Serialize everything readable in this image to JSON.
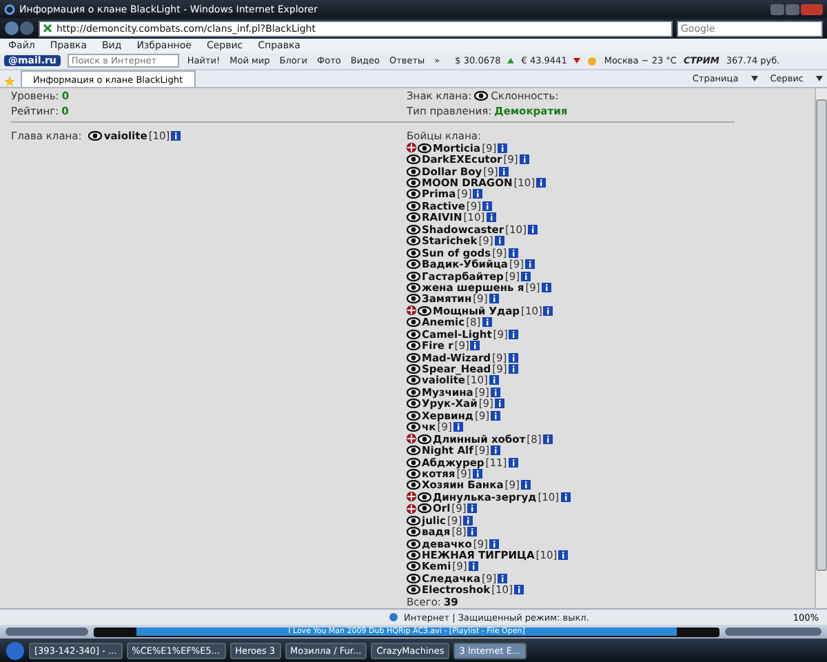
{
  "window": {
    "title": "Информация о клане BlackLight - Windows Internet Explorer"
  },
  "address_bar": {
    "url": "http://demoncity.combats.com/clans_inf.pl?BlackLight",
    "search_placeholder": "Google"
  },
  "menu": [
    "Файл",
    "Правка",
    "Вид",
    "Избранное",
    "Сервис",
    "Справка"
  ],
  "mail_toolbar": {
    "logo": "@mail.ru",
    "search_placeholder": "Поиск в Интернет",
    "search_button": "Найти!",
    "links": [
      "Мой мир",
      "Блоги",
      "Фото",
      "Видео",
      "Ответы"
    ],
    "more": "»",
    "usd": "$ 30.0678",
    "eur": "€ 43.9441",
    "weather": "Москва − 23 °C",
    "stream": "СТРИМ",
    "balance": "367.74 руб."
  },
  "tabs": [
    {
      "label": "Информация о клане BlackLight",
      "selected": true
    }
  ],
  "command_bar": [
    "Страница",
    "Сервис"
  ],
  "clan": {
    "level_label": "Уровень:",
    "level": "0",
    "rating_label": "Рейтинг:",
    "rating": "0",
    "sign_label": "Знак клана:",
    "alignment_label": "Склонность:",
    "government_label": "Тип правления:",
    "government": "Демократия",
    "head_label": "Глава клана:",
    "head": {
      "name": "vaiolite",
      "level": "[10]"
    },
    "members_label": "Бойцы клана:",
    "members": [
      {
        "name": "Morticia",
        "level": "[9]",
        "emblem": true
      },
      {
        "name": "DarkEXEcutor",
        "level": "[9]",
        "emblem": false
      },
      {
        "name": "Dollar Boy",
        "level": "[9]",
        "emblem": false
      },
      {
        "name": "MOON DRAGON",
        "level": "[10]",
        "emblem": false
      },
      {
        "name": "Prima",
        "level": "[9]",
        "emblem": false
      },
      {
        "name": "Ractive",
        "level": "[9]",
        "emblem": false
      },
      {
        "name": "RAIVIN",
        "level": "[10]",
        "emblem": false
      },
      {
        "name": "Shadowcaster",
        "level": "[10]",
        "emblem": false
      },
      {
        "name": "Starichek",
        "level": "[9]",
        "emblem": false
      },
      {
        "name": "Sun of gods",
        "level": "[9]",
        "emblem": false
      },
      {
        "name": "Вадик-Убийца",
        "level": "[9]",
        "emblem": false
      },
      {
        "name": "Гастарбайтер",
        "level": "[9]",
        "emblem": false
      },
      {
        "name": "жена шершень я",
        "level": "[9]",
        "emblem": false
      },
      {
        "name": "Замятин",
        "level": "[9]",
        "emblem": false
      },
      {
        "name": "Мощный Удар",
        "level": "[10]",
        "emblem": true
      },
      {
        "name": "Anemic",
        "level": "[8]",
        "emblem": false
      },
      {
        "name": "Camel-Light",
        "level": "[9]",
        "emblem": false
      },
      {
        "name": "Fire r",
        "level": "[9]",
        "emblem": false
      },
      {
        "name": "Mad-Wizard",
        "level": "[9]",
        "emblem": false
      },
      {
        "name": "Spear_Head",
        "level": "[9]",
        "emblem": false
      },
      {
        "name": "vaiolite",
        "level": "[10]",
        "emblem": false
      },
      {
        "name": "Музчина",
        "level": "[9]",
        "emblem": false
      },
      {
        "name": "Урук-Хай",
        "level": "[9]",
        "emblem": false
      },
      {
        "name": "Хервинд",
        "level": "[9]",
        "emblem": false
      },
      {
        "name": "чк",
        "level": "[9]",
        "emblem": false
      },
      {
        "name": "Длинный хобот",
        "level": "[8]",
        "emblem": true
      },
      {
        "name": "Night Alf",
        "level": "[9]",
        "emblem": false
      },
      {
        "name": "Абджурер",
        "level": "[11]",
        "emblem": false
      },
      {
        "name": "котяя",
        "level": "[9]",
        "emblem": false
      },
      {
        "name": "Хозяин Банка",
        "level": "[9]",
        "emblem": false
      },
      {
        "name": "Динулька-зергуд",
        "level": "[10]",
        "emblem": true
      },
      {
        "name": "Orl",
        "level": "[9]",
        "emblem": true
      },
      {
        "name": "julic",
        "level": "[9]",
        "emblem": false
      },
      {
        "name": "вадя",
        "level": "[8]",
        "emblem": false
      },
      {
        "name": "девачко",
        "level": "[9]",
        "emblem": false
      },
      {
        "name": "НЕЖНАЯ ТИГРИЦА",
        "level": "[10]",
        "emblem": false
      },
      {
        "name": "Kemi",
        "level": "[9]",
        "emblem": false
      },
      {
        "name": "Следачка",
        "level": "[9]",
        "emblem": false
      },
      {
        "name": "Electroshok",
        "level": "[10]",
        "emblem": false
      }
    ],
    "total_label": "Всего:",
    "total": "39"
  },
  "status_bar": {
    "zone": "Интернет | Защищенный режим: выкл.",
    "zoom": "100%"
  },
  "media_player": {
    "track": "I Love You Man 2009 Dub HQRip AC3.avi - [Playlist - File Open]"
  },
  "taskbar": [
    {
      "label": "[393-142-340] - ...",
      "selected": false
    },
    {
      "label": "%CE%E1%EF%E5...",
      "selected": false
    },
    {
      "label": "Heroes 3",
      "selected": false
    },
    {
      "label": "Мозилла / Fur...",
      "selected": false
    },
    {
      "label": "CrazyMachines",
      "selected": false
    },
    {
      "label": "3 Internet E...",
      "selected": true
    }
  ]
}
